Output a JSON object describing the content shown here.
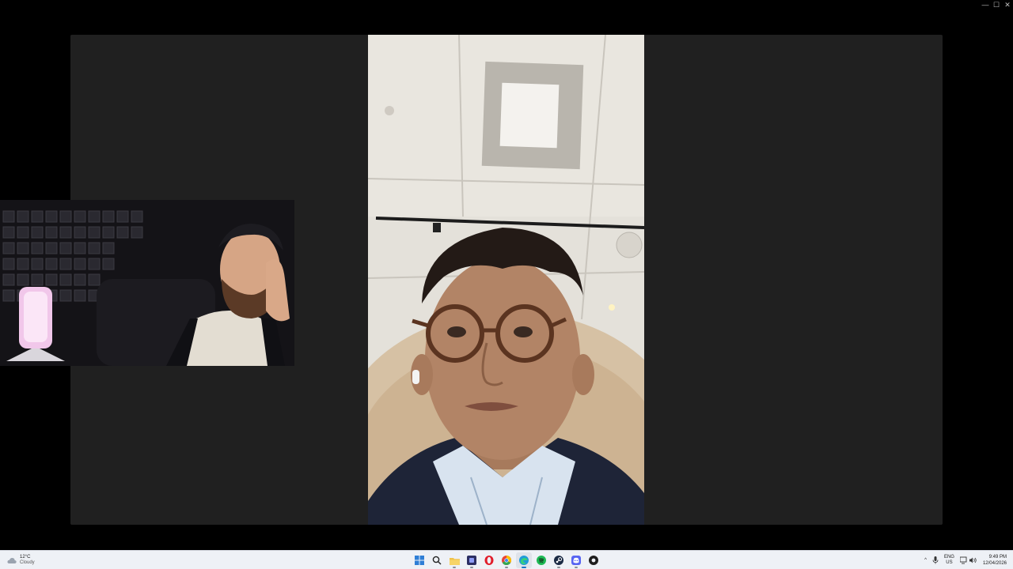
{
  "window": {
    "controls": [
      "—",
      "☐",
      "✕"
    ]
  },
  "call": {
    "main_participant_name": "",
    "pip_participant_name": ""
  },
  "taskbar": {
    "weather": {
      "temp": "12°C",
      "desc": "Cloudy",
      "icon": "cloud-icon"
    },
    "apps": [
      {
        "name": "start",
        "icon": "windows-icon",
        "active": false
      },
      {
        "name": "search",
        "icon": "search-icon",
        "active": false
      },
      {
        "name": "file-explorer",
        "icon": "folder-icon",
        "active": false
      },
      {
        "name": "app-dark",
        "icon": "dark-square-icon",
        "active": false
      },
      {
        "name": "opera",
        "icon": "opera-icon",
        "active": false
      },
      {
        "name": "chrome",
        "icon": "chrome-icon",
        "active": false
      },
      {
        "name": "edge",
        "icon": "edge-icon",
        "active": true
      },
      {
        "name": "spotify",
        "icon": "spotify-icon",
        "active": false
      },
      {
        "name": "steam",
        "icon": "steam-icon",
        "active": false
      },
      {
        "name": "discord",
        "icon": "discord-icon",
        "active": false
      },
      {
        "name": "app-round",
        "icon": "round-app-icon",
        "active": false
      }
    ],
    "tray": {
      "chevron": "^",
      "lang_top": "ENG",
      "lang_bottom": "US",
      "time": "9:49 PM",
      "date": "12/04/2026"
    }
  },
  "colors": {
    "stage": "#202020",
    "taskbar": "#eef1f6",
    "accent": "#1a73c8"
  }
}
